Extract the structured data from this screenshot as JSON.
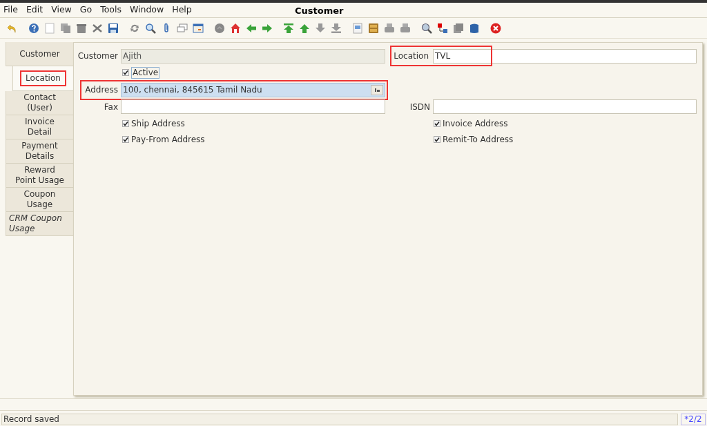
{
  "menu": [
    "File",
    "Edit",
    "View",
    "Go",
    "Tools",
    "Window",
    "Help"
  ],
  "window": {
    "title": "Customer"
  },
  "tabs": [
    {
      "label": "Customer",
      "selected": false,
      "disabled": false,
      "highlighted": false
    },
    {
      "label": "Location",
      "selected": true,
      "disabled": false,
      "highlighted": true
    },
    {
      "label": "Contact (User)",
      "selected": false,
      "disabled": false,
      "highlighted": false
    },
    {
      "label": "Invoice Detail",
      "selected": false,
      "disabled": false,
      "highlighted": false
    },
    {
      "label": "Payment Details",
      "selected": false,
      "disabled": false,
      "highlighted": false
    },
    {
      "label": "Reward Point Usage",
      "selected": false,
      "disabled": false,
      "highlighted": false
    },
    {
      "label": "Coupon Usage",
      "selected": false,
      "disabled": false,
      "highlighted": false
    },
    {
      "label": "CRM Coupon Usage",
      "selected": false,
      "disabled": true,
      "highlighted": false
    }
  ],
  "form": {
    "customer": {
      "label": "Customer",
      "value": "Ajith",
      "disabled": true
    },
    "location": {
      "label": "Location",
      "value": "TVL",
      "highlighted": true
    },
    "active": {
      "label": "Active",
      "checked": true
    },
    "address": {
      "label": "Address",
      "value": "100, chennai,  845615 Tamil Nadu",
      "highlighted": true
    },
    "fax": {
      "label": "Fax"
    },
    "isdn": {
      "label": "ISDN"
    },
    "left_checks": [
      {
        "label": "Ship Address",
        "checked": true
      },
      {
        "label": "Pay-From Address",
        "checked": true
      }
    ],
    "right_checks": [
      {
        "label": "Invoice Address",
        "checked": true
      },
      {
        "label": "Remit-To Address",
        "checked": true
      }
    ]
  },
  "status_bar": {
    "message": "Record saved",
    "record": "*2/2"
  }
}
